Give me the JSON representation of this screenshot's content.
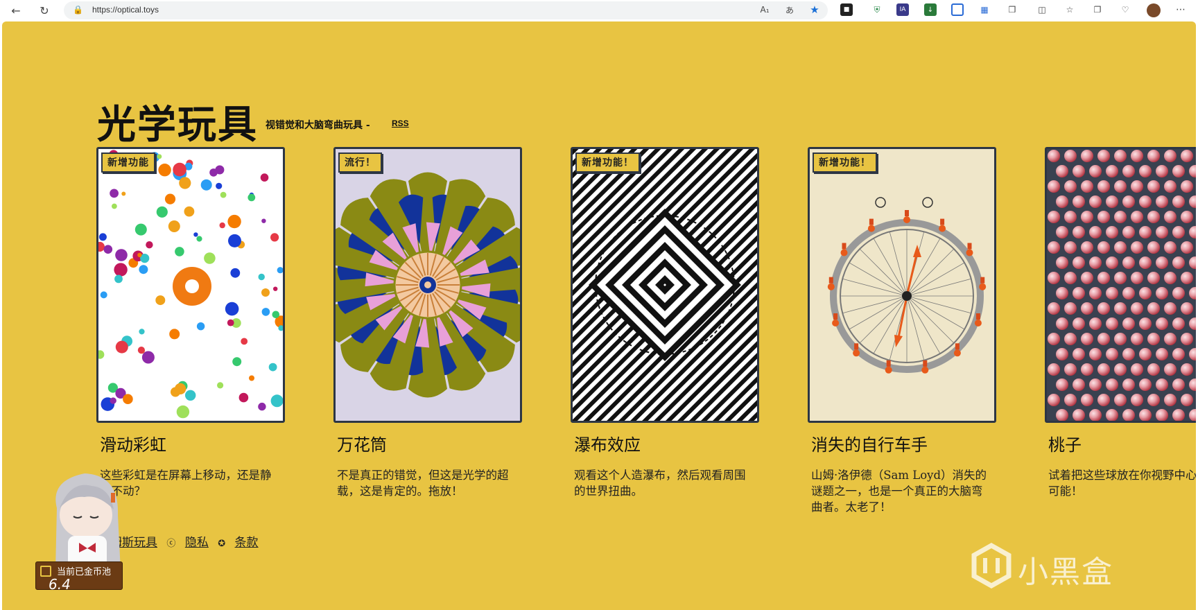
{
  "browser": {
    "url": "https://optical.toys"
  },
  "page": {
    "title": "光学玩具",
    "subtitle": "视错觉和大脑弯曲玩具 -",
    "rss": "RSS"
  },
  "cards": [
    {
      "badge": "新增功能",
      "title": "滑动彩虹",
      "desc": "这些彩虹是在屏幕上移动，还是静止不动？"
    },
    {
      "badge": "流行！",
      "title": "万花筒",
      "desc": "不是真正的错觉，但这是光学的超载，这是肯定的。拖放！"
    },
    {
      "badge": "新增功能！",
      "title": "瀑布效应",
      "desc": "观看这个人造瀑布，然后观看周围的世界扭曲。"
    },
    {
      "badge": "新增功能！",
      "title": "消失的自行车手",
      "desc": "山姆·洛伊德（Sam Loyd）消失的谜题之一，也是一个真正的大脑弯曲者。太老了！"
    },
    {
      "badge": "",
      "title": "桃子",
      "desc": "试着把这些球放在你视野中心，不可能！"
    }
  ],
  "footer": {
    "brand": "姆斯玩具",
    "privacy": "隐私",
    "terms": "条款"
  },
  "overlay": {
    "coin_label": "当前已金币池",
    "coin_value": "6.4"
  },
  "watermark": {
    "text": "小黑盒"
  },
  "colors": {
    "page_bg": "#e8c442",
    "card_border": "#2d3644"
  }
}
